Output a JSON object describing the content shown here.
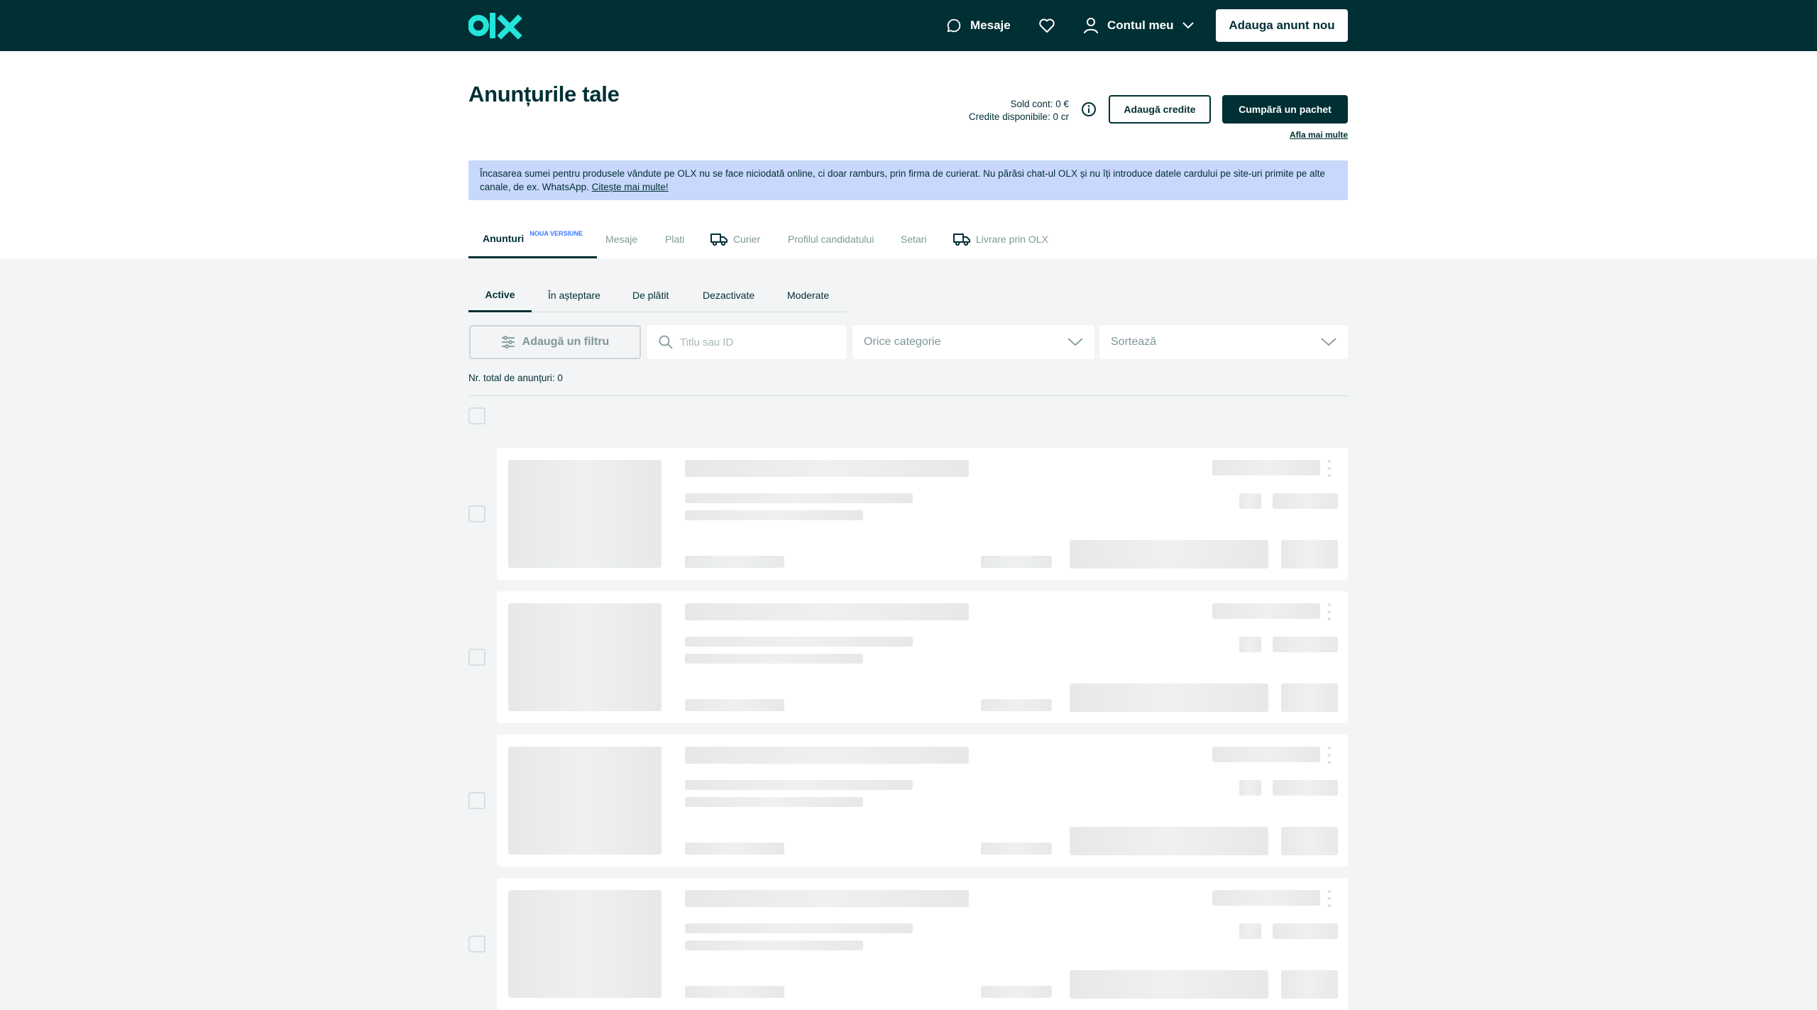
{
  "header": {
    "messages_label": "Mesaje",
    "account_label": "Contul meu",
    "post_ad_label": "Adauga anunt nou",
    "icons": {
      "logo": "olx-logo",
      "messages": "chat-icon",
      "favorites": "heart-icon",
      "account": "user-icon",
      "account_menu": "chevron-down-icon"
    }
  },
  "page": {
    "title": "Anunțurile tale",
    "balance_label": "Sold cont: 0 €",
    "credits_label": "Credite disponibile: 0 cr",
    "add_credits_label": "Adaugă credite",
    "buy_package_label": "Cumpără un pachet",
    "learn_more_label": "Afla mai multe"
  },
  "alert": {
    "text": "Încasarea sumei pentru produsele vândute pe OLX nu se face niciodată online, ci doar ramburs, prin firma de curierat. Nu părăsi chat-ul OLX și nu îți introduce datele cardului pe site-uri primite pe alte canale, de ex. WhatsApp.",
    "link_label": "Citește mai multe!"
  },
  "main_tabs": [
    {
      "label": "Anunturi",
      "badge": "NOUA VERSIUNE"
    },
    {
      "label": "Mesaje"
    },
    {
      "label": "Plati"
    },
    {
      "label": "Curier"
    },
    {
      "label": "Profilul candidatului"
    },
    {
      "label": "Setari"
    },
    {
      "label": "Livrare prin OLX"
    }
  ],
  "sub_tabs": [
    {
      "label": "Active"
    },
    {
      "label": "În așteptare"
    },
    {
      "label": "De plătit"
    },
    {
      "label": "Dezactivate"
    },
    {
      "label": "Moderate"
    }
  ],
  "filters": {
    "add_filter_label": "Adaugă un filtru",
    "search_placeholder": "Titlu sau ID",
    "category_label": "Orice categorie",
    "sort_label": "Sortează"
  },
  "total_label": "Nr. total de anunțuri: 0",
  "colors": {
    "brand_dark": "#002f34",
    "brand_accent": "#23e5db",
    "alert_bg": "#c8d7fc",
    "badge_new": "#3a77ff"
  }
}
